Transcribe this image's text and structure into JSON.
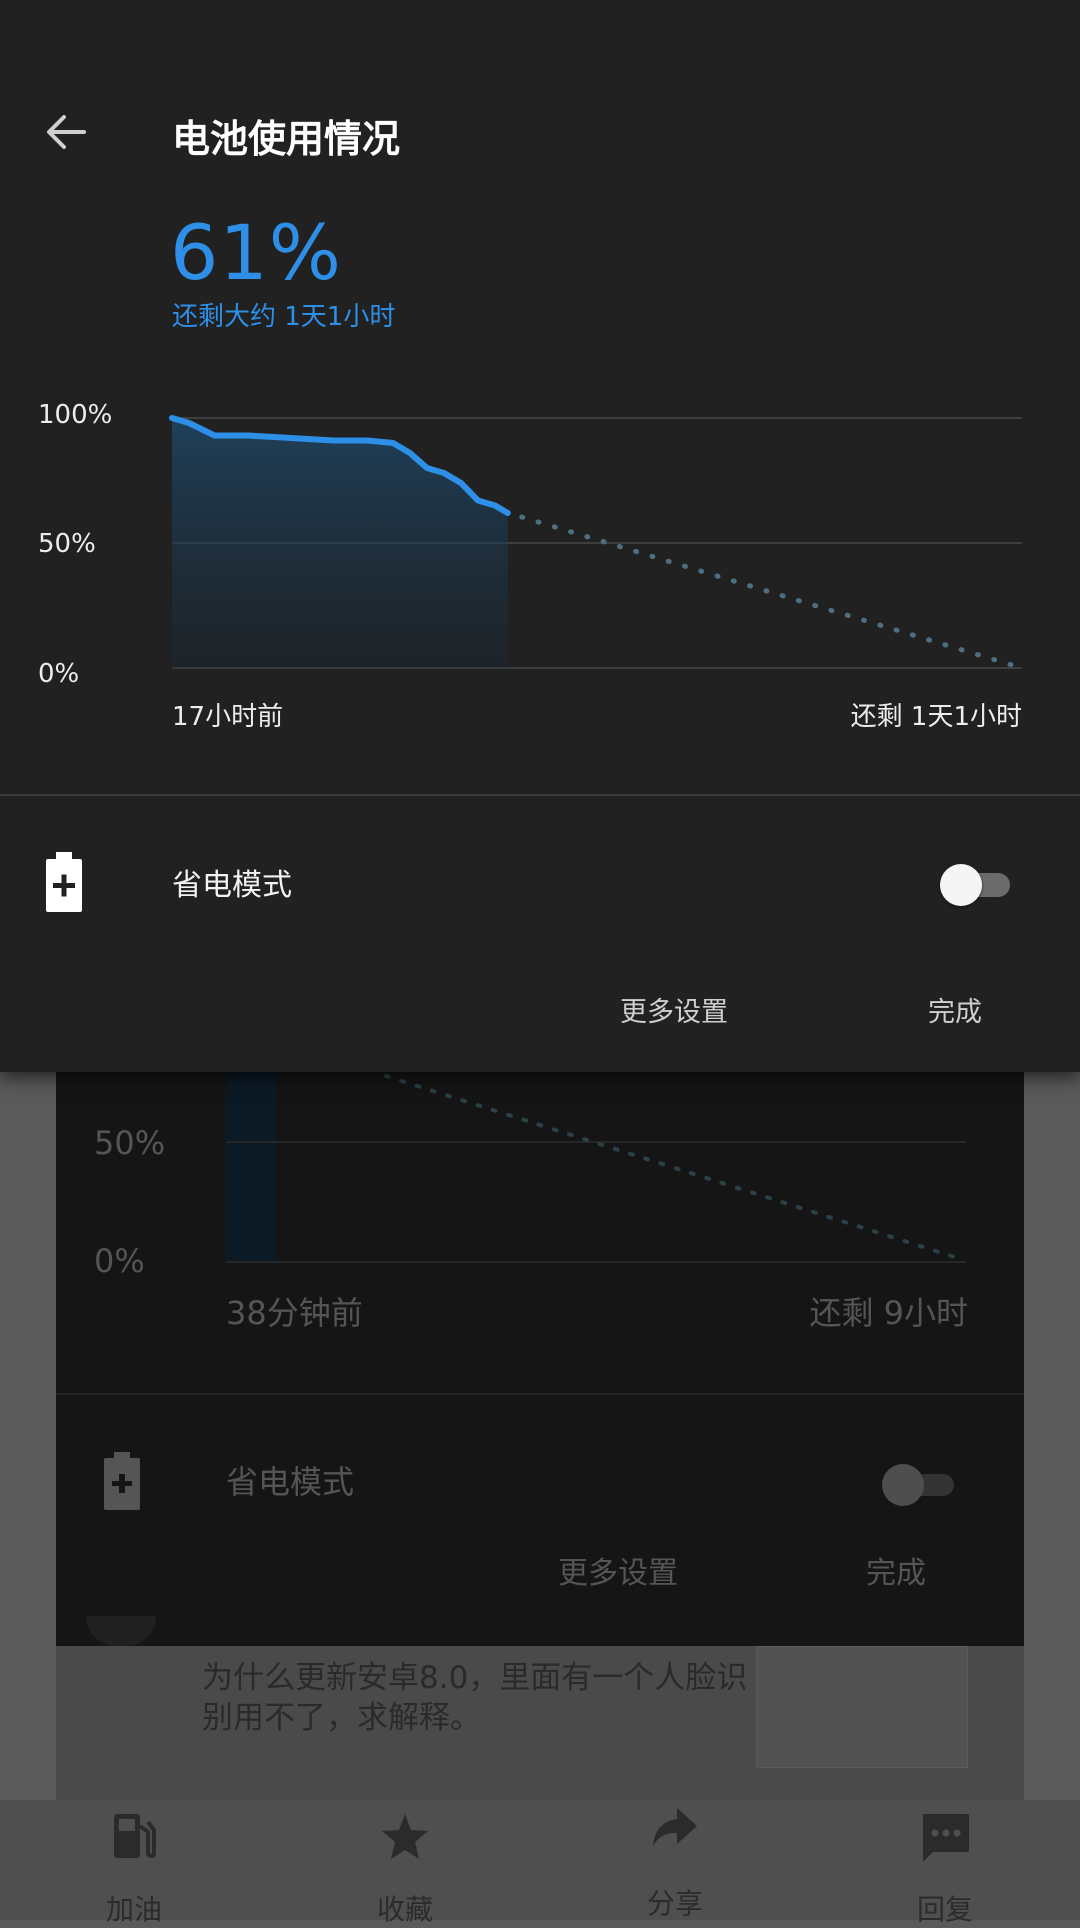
{
  "header": {
    "title": "电池使用情况"
  },
  "battery": {
    "percent": "61%",
    "remaining": "还剩大约 1天1小时"
  },
  "chart": {
    "y_labels": [
      "100%",
      "50%",
      "0%"
    ],
    "x_start": "17小时前",
    "x_end": "还剩 1天1小时",
    "line_color": "#2d8fe8"
  },
  "chart_data": {
    "type": "line",
    "title": "",
    "xlabel": "",
    "ylabel": "",
    "ylim": [
      0,
      100
    ],
    "x_tick_labels": [
      "17小时前",
      "还剩 1天1小时"
    ],
    "y_tick_labels": [
      "100%",
      "50%",
      "0%"
    ],
    "series": [
      {
        "style": "solid",
        "x_fraction": [
          0.0,
          0.02,
          0.05,
          0.09,
          0.14,
          0.19,
          0.23,
          0.26,
          0.28,
          0.3,
          0.32,
          0.34,
          0.36,
          0.38,
          0.395
        ],
        "values": [
          100,
          98,
          93,
          93,
          92,
          91,
          91,
          90,
          86,
          80,
          78,
          74,
          67,
          65,
          62
        ]
      },
      {
        "style": "dotted",
        "x_fraction": [
          0.395,
          1.0
        ],
        "values": [
          62,
          0
        ]
      }
    ]
  },
  "power_saver": {
    "label": "省电模式",
    "enabled": false
  },
  "actions": {
    "more_settings": "更多设置",
    "done": "完成"
  },
  "background": {
    "y_50": "50%",
    "y_0": "0%",
    "x_start": "38分钟前",
    "x_end": "还剩 9小时",
    "saver_label": "省电模式",
    "more_settings": "更多设置",
    "done": "完成",
    "post_text": "为什么更新安卓8.0，里面有一个人脸识别用不了，求解释。"
  },
  "bottom_nav": {
    "items": [
      {
        "label": "加油",
        "icon": "fuel-icon"
      },
      {
        "label": "收藏",
        "icon": "star-icon"
      },
      {
        "label": "分享",
        "icon": "share-icon"
      },
      {
        "label": "回复",
        "icon": "comment-icon"
      }
    ]
  }
}
